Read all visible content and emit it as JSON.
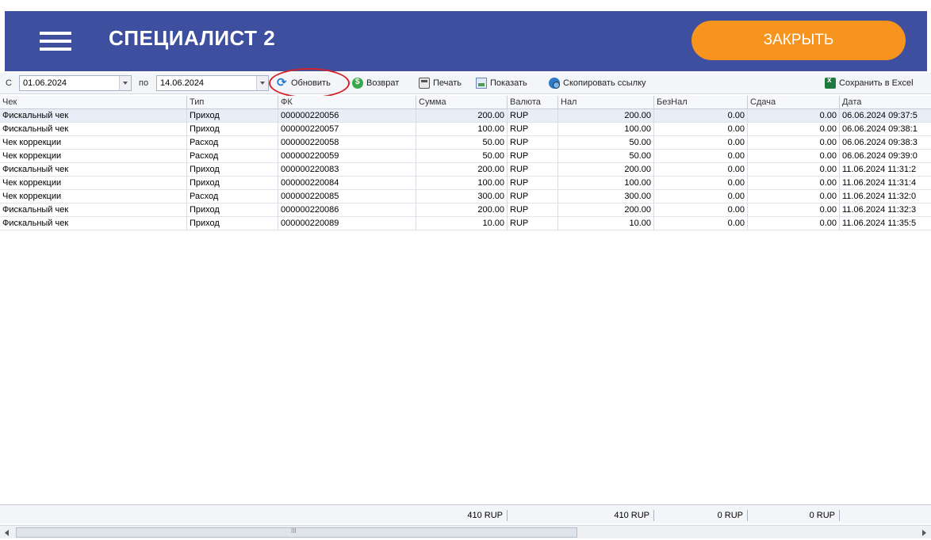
{
  "header": {
    "title": "СПЕЦИАЛИСТ 2",
    "close_label": "ЗАКРЫТЬ",
    "background": "#3f4f9f",
    "close_color": "#f7941d"
  },
  "toolbar": {
    "from_label": "С",
    "from_date": "01.06.2024",
    "to_label": "по",
    "to_date": "14.06.2024",
    "refresh_label": "Обновить",
    "return_label": "Возврат",
    "print_label": "Печать",
    "show_label": "Показать",
    "copy_link_label": "Скопировать ссылку",
    "excel_label": "Сохранить в Excel"
  },
  "table": {
    "columns": [
      "Чек",
      "Тип",
      "ФК",
      "Сумма",
      "Валюта",
      "Нал",
      "БезНал",
      "Сдача",
      "Дата"
    ],
    "rows": [
      [
        "Фискальный чек",
        "Приход",
        "000000220056",
        "200.00",
        "RUP",
        "200.00",
        "0.00",
        "0.00",
        "06.06.2024 09:37:5"
      ],
      [
        "Фискальный чек",
        "Приход",
        "000000220057",
        "100.00",
        "RUP",
        "100.00",
        "0.00",
        "0.00",
        "06.06.2024 09:38:1"
      ],
      [
        "Чек коррекции",
        "Расход",
        "000000220058",
        "50.00",
        "RUP",
        "50.00",
        "0.00",
        "0.00",
        "06.06.2024 09:38:3"
      ],
      [
        "Чек коррекции",
        "Расход",
        "000000220059",
        "50.00",
        "RUP",
        "50.00",
        "0.00",
        "0.00",
        "06.06.2024 09:39:0"
      ],
      [
        "Фискальный чек",
        "Приход",
        "000000220083",
        "200.00",
        "RUP",
        "200.00",
        "0.00",
        "0.00",
        "11.06.2024 11:31:2"
      ],
      [
        "Чек коррекции",
        "Приход",
        "000000220084",
        "100.00",
        "RUP",
        "100.00",
        "0.00",
        "0.00",
        "11.06.2024 11:31:4"
      ],
      [
        "Чек коррекции",
        "Расход",
        "000000220085",
        "300.00",
        "RUP",
        "300.00",
        "0.00",
        "0.00",
        "11.06.2024 11:32:0"
      ],
      [
        "Фискальный чек",
        "Приход",
        "000000220086",
        "200.00",
        "RUP",
        "200.00",
        "0.00",
        "0.00",
        "11.06.2024 11:32:3"
      ],
      [
        "Фискальный чек",
        "Приход",
        "000000220089",
        "10.00",
        "RUP",
        "10.00",
        "0.00",
        "0.00",
        "11.06.2024 11:35:5"
      ]
    ]
  },
  "totals": {
    "sum": "410 RUP",
    "cash": "410 RUP",
    "cashless": "0 RUP",
    "change": "0 RUP"
  }
}
